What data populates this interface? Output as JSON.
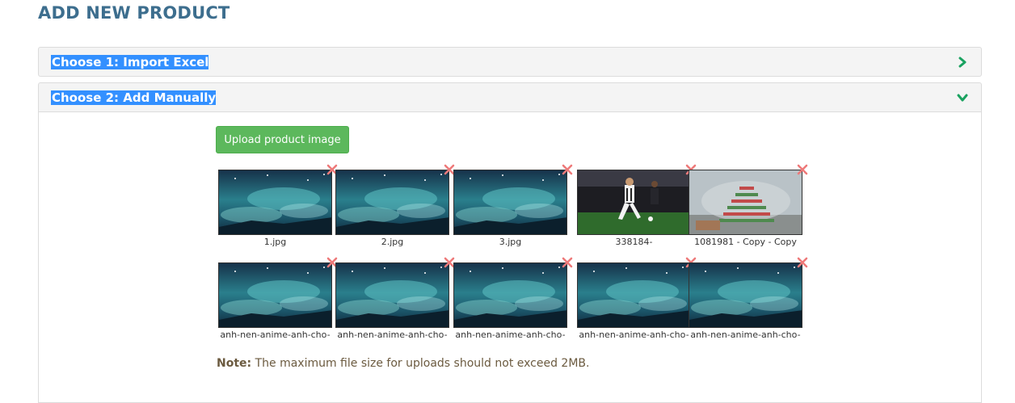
{
  "page": {
    "title": "ADD NEW PRODUCT"
  },
  "panels": [
    {
      "label": "Choose 1: Import Excel",
      "state": "collapsed",
      "icon": "chevron-right-icon"
    },
    {
      "label": "Choose 2: Add Manually",
      "state": "expanded",
      "icon": "chevron-down-icon"
    }
  ],
  "upload": {
    "button_label": "Upload product image"
  },
  "images": [
    {
      "caption": "1.jpg",
      "kind": "anime"
    },
    {
      "caption": "2.jpg",
      "kind": "anime"
    },
    {
      "caption": "3.jpg",
      "kind": "anime"
    },
    {
      "caption": "338184-",
      "kind": "football"
    },
    {
      "caption": "1081981 - Copy - Copy",
      "kind": "tree"
    },
    {
      "caption": "anh-nen-anime-anh-cho-",
      "kind": "anime"
    },
    {
      "caption": "anh-nen-anime-anh-cho-",
      "kind": "anime"
    },
    {
      "caption": "anh-nen-anime-anh-cho-",
      "kind": "anime"
    },
    {
      "caption": "anh-nen-anime-anh-cho-",
      "kind": "anime"
    },
    {
      "caption": "anh-nen-anime-anh-cho-",
      "kind": "anime"
    }
  ],
  "note": {
    "prefix": "Note:",
    "text": " The maximum file size for uploads should not exceed 2MB."
  },
  "colors": {
    "title": "#3d6e8e",
    "chevron": "#1aa260",
    "remove": "#ee7a7a",
    "button": "#5cb85c",
    "highlight": "#3390ff"
  }
}
